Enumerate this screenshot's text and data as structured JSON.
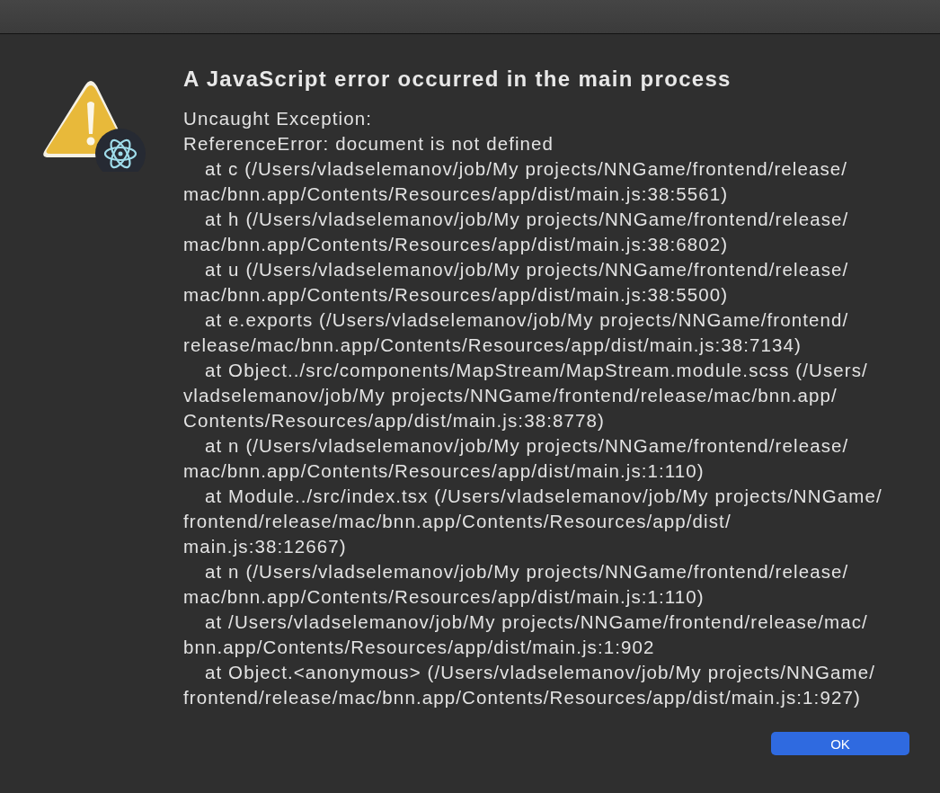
{
  "dialog": {
    "title": "A JavaScript error occurred in the main process",
    "message_lines": [
      {
        "text": "Uncaught Exception:",
        "indented": false
      },
      {
        "text": "ReferenceError: document is not defined",
        "indented": false
      },
      {
        "text": "at c (/Users/vladselemanov/job/My projects/NNGame/frontend/release/",
        "indented": true
      },
      {
        "text": "mac/bnn.app/Contents/Resources/app/dist/main.js:38:5561)",
        "indented": false
      },
      {
        "text": "at h (/Users/vladselemanov/job/My projects/NNGame/frontend/release/",
        "indented": true
      },
      {
        "text": "mac/bnn.app/Contents/Resources/app/dist/main.js:38:6802)",
        "indented": false
      },
      {
        "text": "at u (/Users/vladselemanov/job/My projects/NNGame/frontend/release/",
        "indented": true
      },
      {
        "text": "mac/bnn.app/Contents/Resources/app/dist/main.js:38:5500)",
        "indented": false
      },
      {
        "text": "at e.exports (/Users/vladselemanov/job/My projects/NNGame/frontend/",
        "indented": true
      },
      {
        "text": "release/mac/bnn.app/Contents/Resources/app/dist/main.js:38:7134)",
        "indented": false
      },
      {
        "text": "at Object../src/components/MapStream/MapStream.module.scss (/Users/",
        "indented": true
      },
      {
        "text": "vladselemanov/job/My projects/NNGame/frontend/release/mac/bnn.app/",
        "indented": false
      },
      {
        "text": "Contents/Resources/app/dist/main.js:38:8778)",
        "indented": false
      },
      {
        "text": "at n (/Users/vladselemanov/job/My projects/NNGame/frontend/release/",
        "indented": true
      },
      {
        "text": "mac/bnn.app/Contents/Resources/app/dist/main.js:1:110)",
        "indented": false
      },
      {
        "text": "at Module../src/index.tsx (/Users/vladselemanov/job/My projects/NNGame/",
        "indented": true
      },
      {
        "text": "frontend/release/mac/bnn.app/Contents/Resources/app/dist/",
        "indented": false
      },
      {
        "text": "main.js:38:12667)",
        "indented": false
      },
      {
        "text": "at n (/Users/vladselemanov/job/My projects/NNGame/frontend/release/",
        "indented": true
      },
      {
        "text": "mac/bnn.app/Contents/Resources/app/dist/main.js:1:110)",
        "indented": false
      },
      {
        "text": "at /Users/vladselemanov/job/My projects/NNGame/frontend/release/mac/",
        "indented": true
      },
      {
        "text": "bnn.app/Contents/Resources/app/dist/main.js:1:902",
        "indented": false
      },
      {
        "text": "at Object.<anonymous> (/Users/vladselemanov/job/My projects/NNGame/",
        "indented": true
      },
      {
        "text": "frontend/release/mac/bnn.app/Contents/Resources/app/dist/main.js:1:927)",
        "indented": false
      }
    ],
    "buttons": [
      {
        "label": "OK",
        "default": true
      }
    ]
  }
}
